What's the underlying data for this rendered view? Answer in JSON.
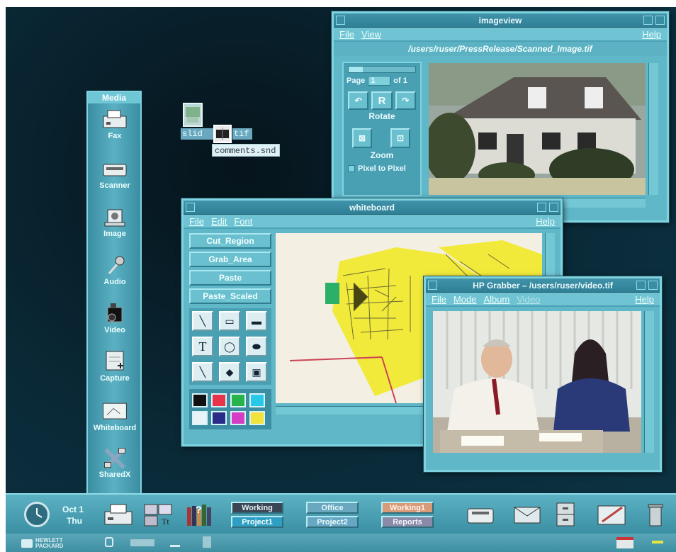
{
  "media_panel": {
    "title": "Media",
    "items": [
      {
        "label": "Fax",
        "icon": "fax-icon"
      },
      {
        "label": "Scanner",
        "icon": "scanner-icon"
      },
      {
        "label": "Image",
        "icon": "image-icon"
      },
      {
        "label": "Audio",
        "icon": "microphone-icon"
      },
      {
        "label": "Video",
        "icon": "video-camera-icon"
      },
      {
        "label": "Capture",
        "icon": "capture-icon"
      },
      {
        "label": "Whiteboard",
        "icon": "whiteboard-icon"
      },
      {
        "label": "SharedX",
        "icon": "sharedx-icon"
      }
    ]
  },
  "desktop": {
    "icon_label_1": "slid",
    "icon_label_2": "tif",
    "icon_label_3": "comments.snd"
  },
  "imageview": {
    "title": "imageview",
    "menu": {
      "file": "File",
      "view": "View",
      "help": "Help"
    },
    "path": "/users/ruser/PressRelease/Scanned_Image.tif",
    "page_label": "Page",
    "page_value": "1",
    "page_of": "of 1",
    "rotate_letter": "R",
    "rotate_label": "Rotate",
    "zoom_label": "Zoom",
    "pixel_label": "Pixel to Pixel"
  },
  "whiteboard": {
    "title": "whiteboard",
    "menu": {
      "file": "File",
      "edit": "Edit",
      "font": "Font",
      "help": "Help"
    },
    "buttons": [
      "Cut_Region",
      "Grab_Area",
      "Paste",
      "Paste_Scaled"
    ],
    "text_tool": "T",
    "colors": [
      "#111111",
      "#e8344a",
      "#27b24a",
      "#28c8e8",
      "#e9f4f7",
      "#2a2a8a",
      "#d63cc4",
      "#f2e23a"
    ]
  },
  "grabber": {
    "title": "HP Grabber – /users/ruser/video.tif",
    "menu": {
      "file": "File",
      "mode": "Mode",
      "album": "Album",
      "video": "Video",
      "help": "Help"
    }
  },
  "frontpanel": {
    "date": "Oct 1",
    "day": "Thu",
    "workspaces": [
      {
        "label": "Working",
        "bg": "#3a4656",
        "fg": "#e7eef2"
      },
      {
        "label": "Office",
        "bg": "#6aa8bf",
        "fg": "#e7f6fa"
      },
      {
        "label": "Working1",
        "bg": "#d99a78",
        "fg": "#fff3ec"
      },
      {
        "label": "Project1",
        "bg": "#2e9ec3",
        "fg": "#f2ffff"
      },
      {
        "label": "Project2",
        "bg": "#66a8c4",
        "fg": "#eef9fc"
      },
      {
        "label": "Reports",
        "bg": "#8a8aa8",
        "fg": "#f2f2ff"
      }
    ],
    "logo_text": "HEWLETT PACKARD"
  }
}
